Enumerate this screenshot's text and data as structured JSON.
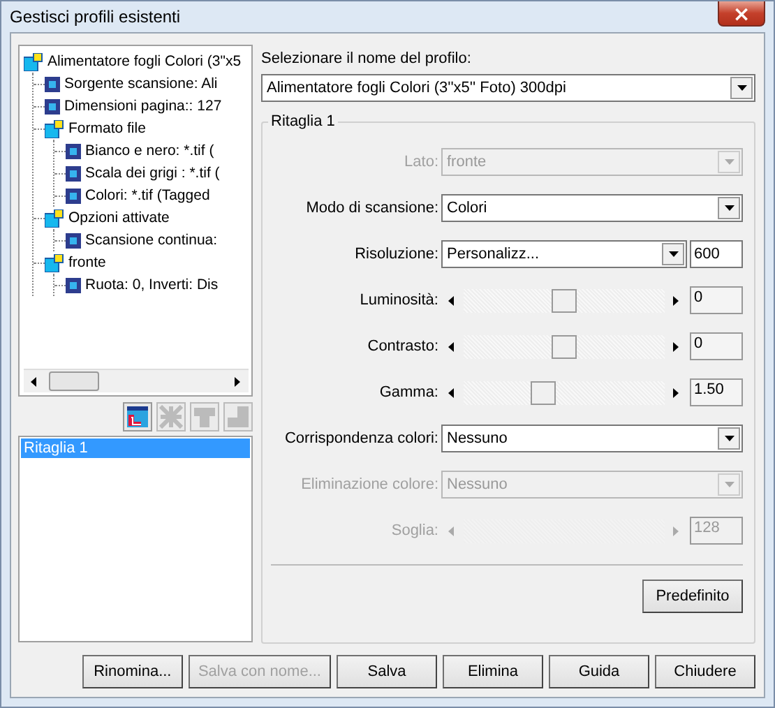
{
  "window": {
    "title": "Gestisci profili esistenti",
    "close": "×"
  },
  "tree": [
    {
      "label": "Alimentatore fogli Colori (3\"x5",
      "kind": "folder",
      "children": [
        {
          "label": "Sorgente scansione: Ali",
          "kind": "leaf"
        },
        {
          "label": "Dimensioni pagina:: 127",
          "kind": "leaf"
        },
        {
          "label": "Formato file",
          "kind": "folder",
          "children": [
            {
              "label": "Bianco e nero: *.tif (",
              "kind": "leaf"
            },
            {
              "label": "Scala dei grigi : *.tif (",
              "kind": "leaf"
            },
            {
              "label": "Colori: *.tif (Tagged",
              "kind": "leaf"
            }
          ]
        },
        {
          "label": "Opzioni attivate",
          "kind": "folder",
          "children": [
            {
              "label": "Scansione continua:",
              "kind": "leaf"
            }
          ]
        },
        {
          "label": "fronte",
          "kind": "folder",
          "children": [
            {
              "label": "Ruota: 0, Inverti: Dis",
              "kind": "leaf"
            }
          ]
        }
      ]
    }
  ],
  "toolbar": [
    {
      "kind": "new",
      "disabled": false
    },
    {
      "kind": "delete",
      "disabled": true
    },
    {
      "kind": "up",
      "disabled": true
    },
    {
      "kind": "down",
      "disabled": true
    }
  ],
  "crops": [
    {
      "label": "Ritaglia 1",
      "selected": true
    }
  ],
  "profile": {
    "label": "Selezionare il nome del profilo:",
    "value": "Alimentatore fogli Colori (3''x5'' Foto) 300dpi"
  },
  "group": {
    "title": "Ritaglia 1",
    "rows": [
      {
        "kind": "combo",
        "label": "Lato:",
        "value": "fronte",
        "disabled": true
      },
      {
        "kind": "combo",
        "label": "Modo di scansione:",
        "value": "Colori",
        "disabled": false
      },
      {
        "kind": "combo-input",
        "label": "Risoluzione:",
        "value": "Personalizz...",
        "input": "600",
        "disabled": false
      },
      {
        "kind": "slider",
        "label": "Luminosità:",
        "level": 0.5,
        "reading": "0",
        "disabled": false
      },
      {
        "kind": "slider",
        "label": "Contrasto:",
        "level": 0.5,
        "reading": "0",
        "disabled": false
      },
      {
        "kind": "slider",
        "label": "Gamma:",
        "level": 0.38,
        "reading": "1.50",
        "disabled": false
      },
      {
        "kind": "combo",
        "label": "Corrispondenza colori:",
        "value": "Nessuno",
        "disabled": false
      },
      {
        "kind": "combo",
        "label": "Eliminazione colore:",
        "value": "Nessuno",
        "disabled": true
      },
      {
        "kind": "slider",
        "label": "Soglia:",
        "reading": "128",
        "disabled": true
      }
    ],
    "default_button": "Predefinito"
  },
  "buttons": [
    {
      "label": "Rinomina...",
      "disabled": false
    },
    {
      "label": "Salva con nome...",
      "disabled": true
    },
    {
      "label": "Salva",
      "disabled": false
    },
    {
      "label": "Elimina",
      "disabled": false
    },
    {
      "label": "Guida",
      "disabled": false
    },
    {
      "label": "Chiudere",
      "disabled": false
    }
  ]
}
